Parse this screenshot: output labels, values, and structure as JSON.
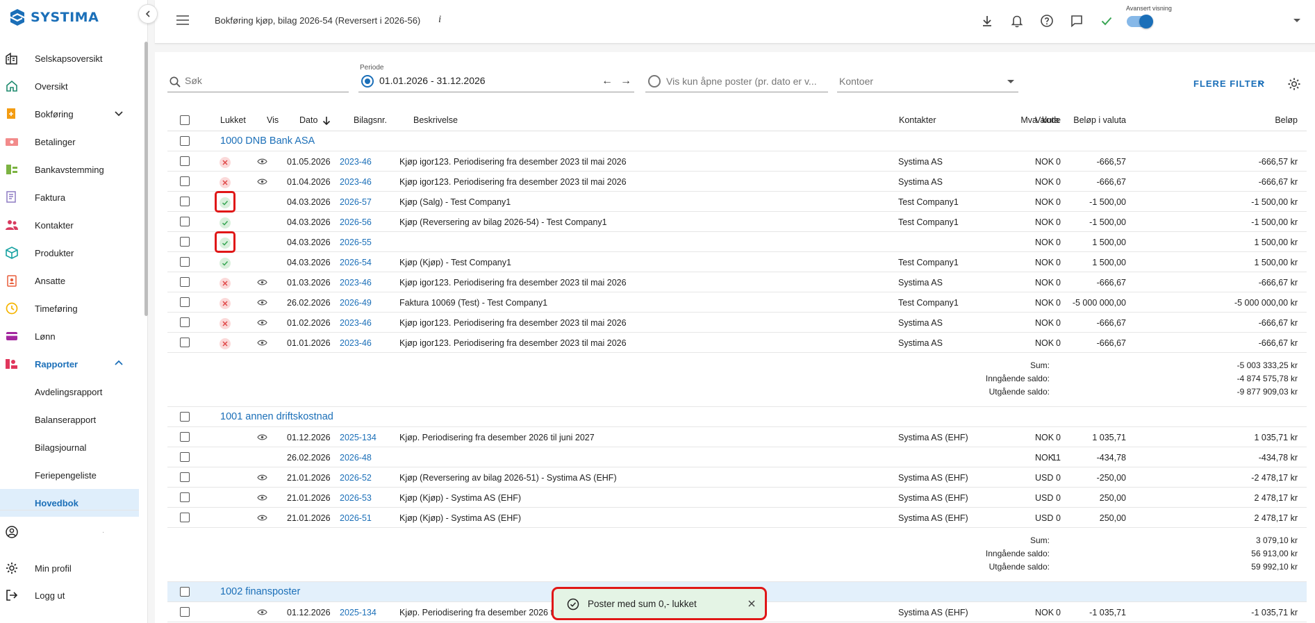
{
  "app": {
    "logo_text": "SYSTIMA",
    "brand_color": "#1b6fb8"
  },
  "sidebar": {
    "items": [
      {
        "label": "Selskapsoversikt",
        "icon": "company-overview-icon"
      },
      {
        "label": "Oversikt",
        "icon": "home-icon"
      },
      {
        "label": "Bokføring",
        "icon": "bookkeeping-icon",
        "expandable": true
      },
      {
        "label": "Betalinger",
        "icon": "payments-icon"
      },
      {
        "label": "Bankavstemming",
        "icon": "bank-reconciliation-icon"
      },
      {
        "label": "Faktura",
        "icon": "invoice-icon"
      },
      {
        "label": "Kontakter",
        "icon": "contacts-icon"
      },
      {
        "label": "Produkter",
        "icon": "products-icon"
      },
      {
        "label": "Ansatte",
        "icon": "employees-icon"
      },
      {
        "label": "Timeføring",
        "icon": "clock-icon"
      },
      {
        "label": "Lønn",
        "icon": "salary-icon"
      },
      {
        "label": "Rapporter",
        "icon": "reports-icon",
        "expanded": true
      }
    ],
    "sub_items": [
      "Avdelingsrapport",
      "Balanserapport",
      "Bilagsjournal",
      "Feriepengeliste",
      "Hovedbok"
    ],
    "active_sub": "Hovedbok",
    "bottom": {
      "account_dot": "·",
      "profile": "Min profil",
      "logout": "Logg ut"
    }
  },
  "topbar": {
    "title": "Bokføring kjøp, bilag 2026-54 (Reversert i 2026-56)",
    "info": "i",
    "advanced_label": "Avansert visning",
    "advanced_on": true
  },
  "filters": {
    "search_placeholder": "Søk",
    "period_label": "Periode",
    "period_value": "01.01.2026 - 31.12.2026",
    "prev_arrow": "←",
    "next_arrow": "→",
    "open_only_label": "Vis kun åpne poster (pr. dato er v...",
    "accounts_placeholder": "Kontoer",
    "more_filters": "FLERE FILTER"
  },
  "table": {
    "headers": {
      "closed": "Lukket",
      "view": "Vis",
      "date": "Dato",
      "voucher": "Bilagsnr.",
      "description": "Beskrivelse",
      "contacts": "Kontakter",
      "vat": "Mva. kode",
      "amount_currency": "Beløp i valuta",
      "currency": "Valuta",
      "amount": "Beløp"
    },
    "sum_labels": {
      "sum": "Sum:",
      "in": "Inngående saldo:",
      "out": "Utgående saldo:"
    },
    "groups": [
      {
        "title": "1000 DNB Bank ASA",
        "rows": [
          {
            "status": "open",
            "eye": true,
            "date": "01.05.2026",
            "voucher": "2023-46",
            "desc": "Kjøp igor123. Periodisering fra desember 2023 til mai 2026",
            "contact": "Systima AS",
            "vat": "0",
            "amt_cur": "-666,57",
            "cur": "NOK",
            "amt": "-666,57 kr"
          },
          {
            "status": "open",
            "eye": true,
            "date": "01.04.2026",
            "voucher": "2023-46",
            "desc": "Kjøp igor123. Periodisering fra desember 2023 til mai 2026",
            "contact": "Systima AS",
            "vat": "0",
            "amt_cur": "-666,67",
            "cur": "NOK",
            "amt": "-666,67 kr"
          },
          {
            "status": "closed",
            "eye": false,
            "boxed": true,
            "date": "04.03.2026",
            "voucher": "2026-57",
            "desc": "Kjøp (Salg) - Test Company1",
            "contact": "Test Company1",
            "vat": "0",
            "amt_cur": "-1 500,00",
            "cur": "NOK",
            "amt": "-1 500,00 kr"
          },
          {
            "status": "closed",
            "eye": false,
            "date": "04.03.2026",
            "voucher": "2026-56",
            "desc": "Kjøp (Reversering av bilag 2026-54) - Test Company1",
            "contact": "Test Company1",
            "vat": "0",
            "amt_cur": "-1 500,00",
            "cur": "NOK",
            "amt": "-1 500,00 kr"
          },
          {
            "status": "closed",
            "eye": false,
            "boxed": true,
            "date": "04.03.2026",
            "voucher": "2026-55",
            "desc": "",
            "contact": "",
            "vat": "0",
            "amt_cur": "1 500,00",
            "cur": "NOK",
            "amt": "1 500,00 kr"
          },
          {
            "status": "closed",
            "eye": false,
            "date": "04.03.2026",
            "voucher": "2026-54",
            "desc": "Kjøp (Kjøp) - Test Company1",
            "contact": "Test Company1",
            "vat": "0",
            "amt_cur": "1 500,00",
            "cur": "NOK",
            "amt": "1 500,00 kr"
          },
          {
            "status": "open",
            "eye": true,
            "date": "01.03.2026",
            "voucher": "2023-46",
            "desc": "Kjøp igor123. Periodisering fra desember 2023 til mai 2026",
            "contact": "Systima AS",
            "vat": "0",
            "amt_cur": "-666,67",
            "cur": "NOK",
            "amt": "-666,67 kr"
          },
          {
            "status": "open",
            "eye": true,
            "date": "26.02.2026",
            "voucher": "2026-49",
            "desc": "Faktura 10069 (Test) - Test Company1",
            "contact": "Test Company1",
            "vat": "0",
            "amt_cur": "-5 000 000,00",
            "cur": "NOK",
            "amt": "-5 000 000,00 kr"
          },
          {
            "status": "open",
            "eye": true,
            "date": "01.02.2026",
            "voucher": "2023-46",
            "desc": "Kjøp igor123. Periodisering fra desember 2023 til mai 2026",
            "contact": "Systima AS",
            "vat": "0",
            "amt_cur": "-666,67",
            "cur": "NOK",
            "amt": "-666,67 kr"
          },
          {
            "status": "open",
            "eye": true,
            "date": "01.01.2026",
            "voucher": "2023-46",
            "desc": "Kjøp igor123. Periodisering fra desember 2023 til mai 2026",
            "contact": "Systima AS",
            "vat": "0",
            "amt_cur": "-666,67",
            "cur": "NOK",
            "amt": "-666,67 kr"
          }
        ],
        "sum": "-5 003 333,25 kr",
        "in_balance": "-4 874 575,78 kr",
        "out_balance": "-9 877 909,03 kr"
      },
      {
        "title": "1001 annen driftskostnad",
        "rows": [
          {
            "status": "none",
            "eye": true,
            "date": "01.12.2026",
            "voucher": "2025-134",
            "desc": "Kjøp. Periodisering fra desember 2026 til juni 2027",
            "contact": "Systima AS (EHF)",
            "vat": "0",
            "amt_cur": "1 035,71",
            "cur": "NOK",
            "amt": "1 035,71 kr"
          },
          {
            "status": "none",
            "eye": false,
            "date": "26.02.2026",
            "voucher": "2026-48",
            "desc": "",
            "contact": "",
            "vat": "11",
            "amt_cur": "-434,78",
            "cur": "NOK",
            "amt": "-434,78 kr"
          },
          {
            "status": "none",
            "eye": true,
            "date": "21.01.2026",
            "voucher": "2026-52",
            "desc": "Kjøp (Reversering av bilag 2026-51) - Systima AS (EHF)",
            "contact": "Systima AS (EHF)",
            "vat": "0",
            "amt_cur": "-250,00",
            "cur": "USD",
            "amt": "-2 478,17 kr"
          },
          {
            "status": "none",
            "eye": true,
            "date": "21.01.2026",
            "voucher": "2026-53",
            "desc": "Kjøp (Kjøp) - Systima AS (EHF)",
            "contact": "Systima AS (EHF)",
            "vat": "0",
            "amt_cur": "250,00",
            "cur": "USD",
            "amt": "2 478,17 kr"
          },
          {
            "status": "none",
            "eye": true,
            "date": "21.01.2026",
            "voucher": "2026-51",
            "desc": "Kjøp (Kjøp) - Systima AS (EHF)",
            "contact": "Systima AS (EHF)",
            "vat": "0",
            "amt_cur": "250,00",
            "cur": "USD",
            "amt": "2 478,17 kr"
          }
        ],
        "sum": "3 079,10 kr",
        "in_balance": "56 913,00 kr",
        "out_balance": "59 992,10 kr"
      },
      {
        "title": "1002 finansposter",
        "highlight": true,
        "rows": [
          {
            "status": "none",
            "eye": true,
            "date": "01.12.2026",
            "voucher": "2025-134",
            "desc": "Kjøp. Periodisering fra desember 2026 til juni 2027",
            "contact": "Systima AS (EHF)",
            "vat": "0",
            "amt_cur": "-1 035,71",
            "cur": "NOK",
            "amt": "-1 035,71 kr"
          }
        ]
      }
    ]
  },
  "toast": {
    "message": "Poster med sum 0,- lukket"
  },
  "colors": {
    "accent": "#1b6fb8",
    "closed_green": "#3aa655",
    "open_red": "#e04a4a",
    "highlight_red": "#e01717"
  }
}
